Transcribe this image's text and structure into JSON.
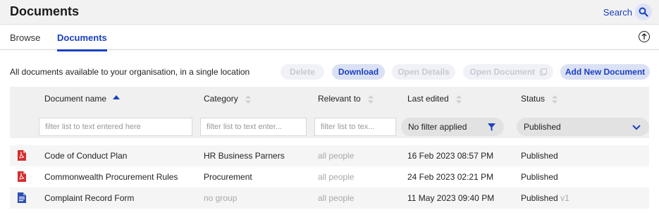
{
  "header": {
    "title": "Documents",
    "search_label": "Search"
  },
  "tabs": [
    {
      "label": "Browse",
      "active": false
    },
    {
      "label": "Documents",
      "active": true
    }
  ],
  "toolbar": {
    "description": "All documents available to your organisation, in a single location",
    "buttons": {
      "delete": {
        "label": "Delete",
        "enabled": false
      },
      "download": {
        "label": "Download",
        "enabled": true
      },
      "open_details": {
        "label": "Open Details",
        "enabled": false
      },
      "open_document": {
        "label": "Open Document",
        "enabled": false
      },
      "add_new": {
        "label": "Add New Document",
        "enabled": true
      }
    }
  },
  "table": {
    "columns": {
      "name": {
        "label": "Document name",
        "sort": "ascending"
      },
      "category": {
        "label": "Category",
        "sort": "none"
      },
      "relevant": {
        "label": "Relevant to",
        "sort": "none"
      },
      "edited": {
        "label": "Last edited",
        "sort": "none"
      },
      "status": {
        "label": "Status",
        "sort": "none"
      }
    },
    "filters": {
      "name_placeholder": "filter list to text entered here",
      "category_placeholder": "filter list to text enter...",
      "relevant_placeholder": "filter list to tex...",
      "edited_value": "No filter applied",
      "status_value": "Published"
    },
    "rows": [
      {
        "icon": "pdf-file-icon",
        "name": "Code of Conduct Plan",
        "category": "HR Business Parners",
        "relevant": "all people",
        "edited": "16 Feb 2023 08:57 PM",
        "status": "Published",
        "version": ""
      },
      {
        "icon": "pdf-file-icon",
        "name": "Commonwealth Procurement Rules",
        "category": "Procurement",
        "relevant": "all people",
        "edited": "24 Feb 2023 02:21 PM",
        "status": "Published",
        "version": ""
      },
      {
        "icon": "word-file-icon",
        "name": "Complaint Record Form",
        "category": "no group",
        "relevant": "all people",
        "edited": "11 May 2023 09:40 PM",
        "status": "Published",
        "version": "v1"
      }
    ]
  },
  "colors": {
    "accent": "#1a3fbf",
    "pdf": "#d32f2f",
    "word": "#2b4fb0"
  }
}
